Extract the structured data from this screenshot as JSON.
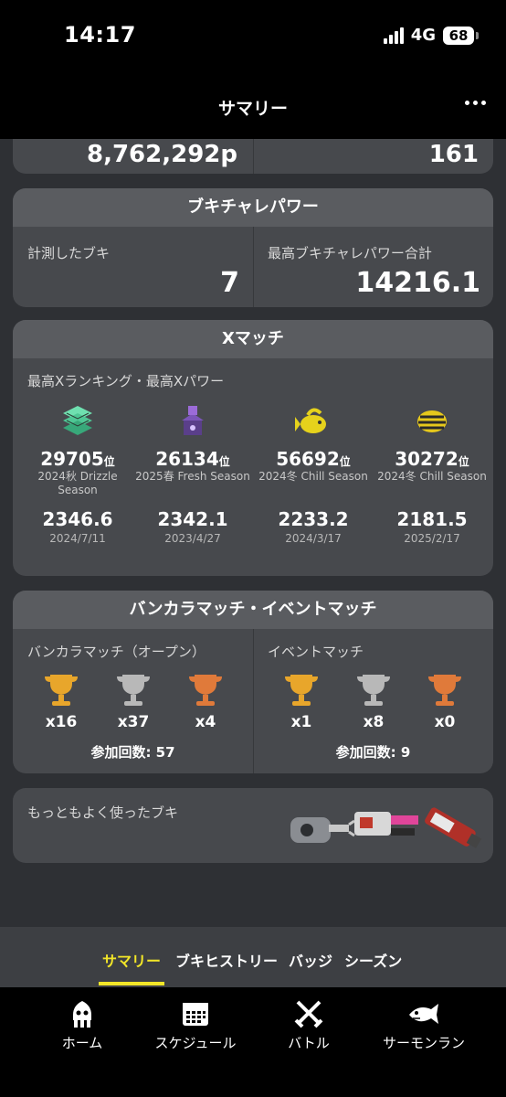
{
  "status": {
    "time": "14:17",
    "network": "4G",
    "battery": "68"
  },
  "header": {
    "title": "サマリー"
  },
  "top_stats": {
    "left_value": "8,762,292p",
    "right_value": "161"
  },
  "challenge_power": {
    "title": "ブキチャレパワー",
    "measured_label": "計測したブキ",
    "measured_value": "7",
    "best_label": "最高ブキチャレパワー合計",
    "best_value": "14216.1"
  },
  "x_match": {
    "title": "Xマッチ",
    "subtitle": "最高Xランキング・最高Xパワー",
    "rank_suffix": "位",
    "entries": [
      {
        "rank": "29705",
        "season_line1": "2024秋 Drizzle",
        "season_line2": "Season",
        "power": "2346.6",
        "date": "2024/7/11",
        "icon": "zone-tower-icon"
      },
      {
        "rank": "26134",
        "season_line1": "2025春 Fresh Season",
        "season_line2": "",
        "power": "2342.1",
        "date": "2023/4/27",
        "icon": "tower-control-icon"
      },
      {
        "rank": "56692",
        "season_line1": "2024冬 Chill Season",
        "season_line2": "",
        "power": "2233.2",
        "date": "2024/3/17",
        "icon": "golden-fish-icon"
      },
      {
        "rank": "30272",
        "season_line1": "2024冬 Chill Season",
        "season_line2": "",
        "power": "2181.5",
        "date": "2025/2/17",
        "icon": "clam-icon"
      }
    ]
  },
  "anarchy_event": {
    "title": "バンカラマッチ・イベントマッチ",
    "anarchy_label": "バンカラマッチ（オープン）",
    "event_label": "イベントマッチ",
    "anarchy_trophies": [
      "x16",
      "x37",
      "x4"
    ],
    "event_trophies": [
      "x1",
      "x8",
      "x0"
    ],
    "anarchy_participation": "参加回数: 57",
    "event_participation": "参加回数: 9",
    "colors": {
      "gold": "#e8a62b",
      "silver": "#b8b8b8",
      "bronze": "#e07a3a"
    }
  },
  "most_used": {
    "label": "もっともよく使ったブキ"
  },
  "tabs": [
    "サマリー",
    "ブキヒストリー",
    "バッジ",
    "シーズン"
  ],
  "bottom_nav": [
    "ホーム",
    "スケジュール",
    "バトル",
    "サーモンラン"
  ],
  "colors": {
    "accent": "#f2e628",
    "card": "#47494d",
    "card_header": "#5a5c60",
    "background": "#2e3034"
  }
}
